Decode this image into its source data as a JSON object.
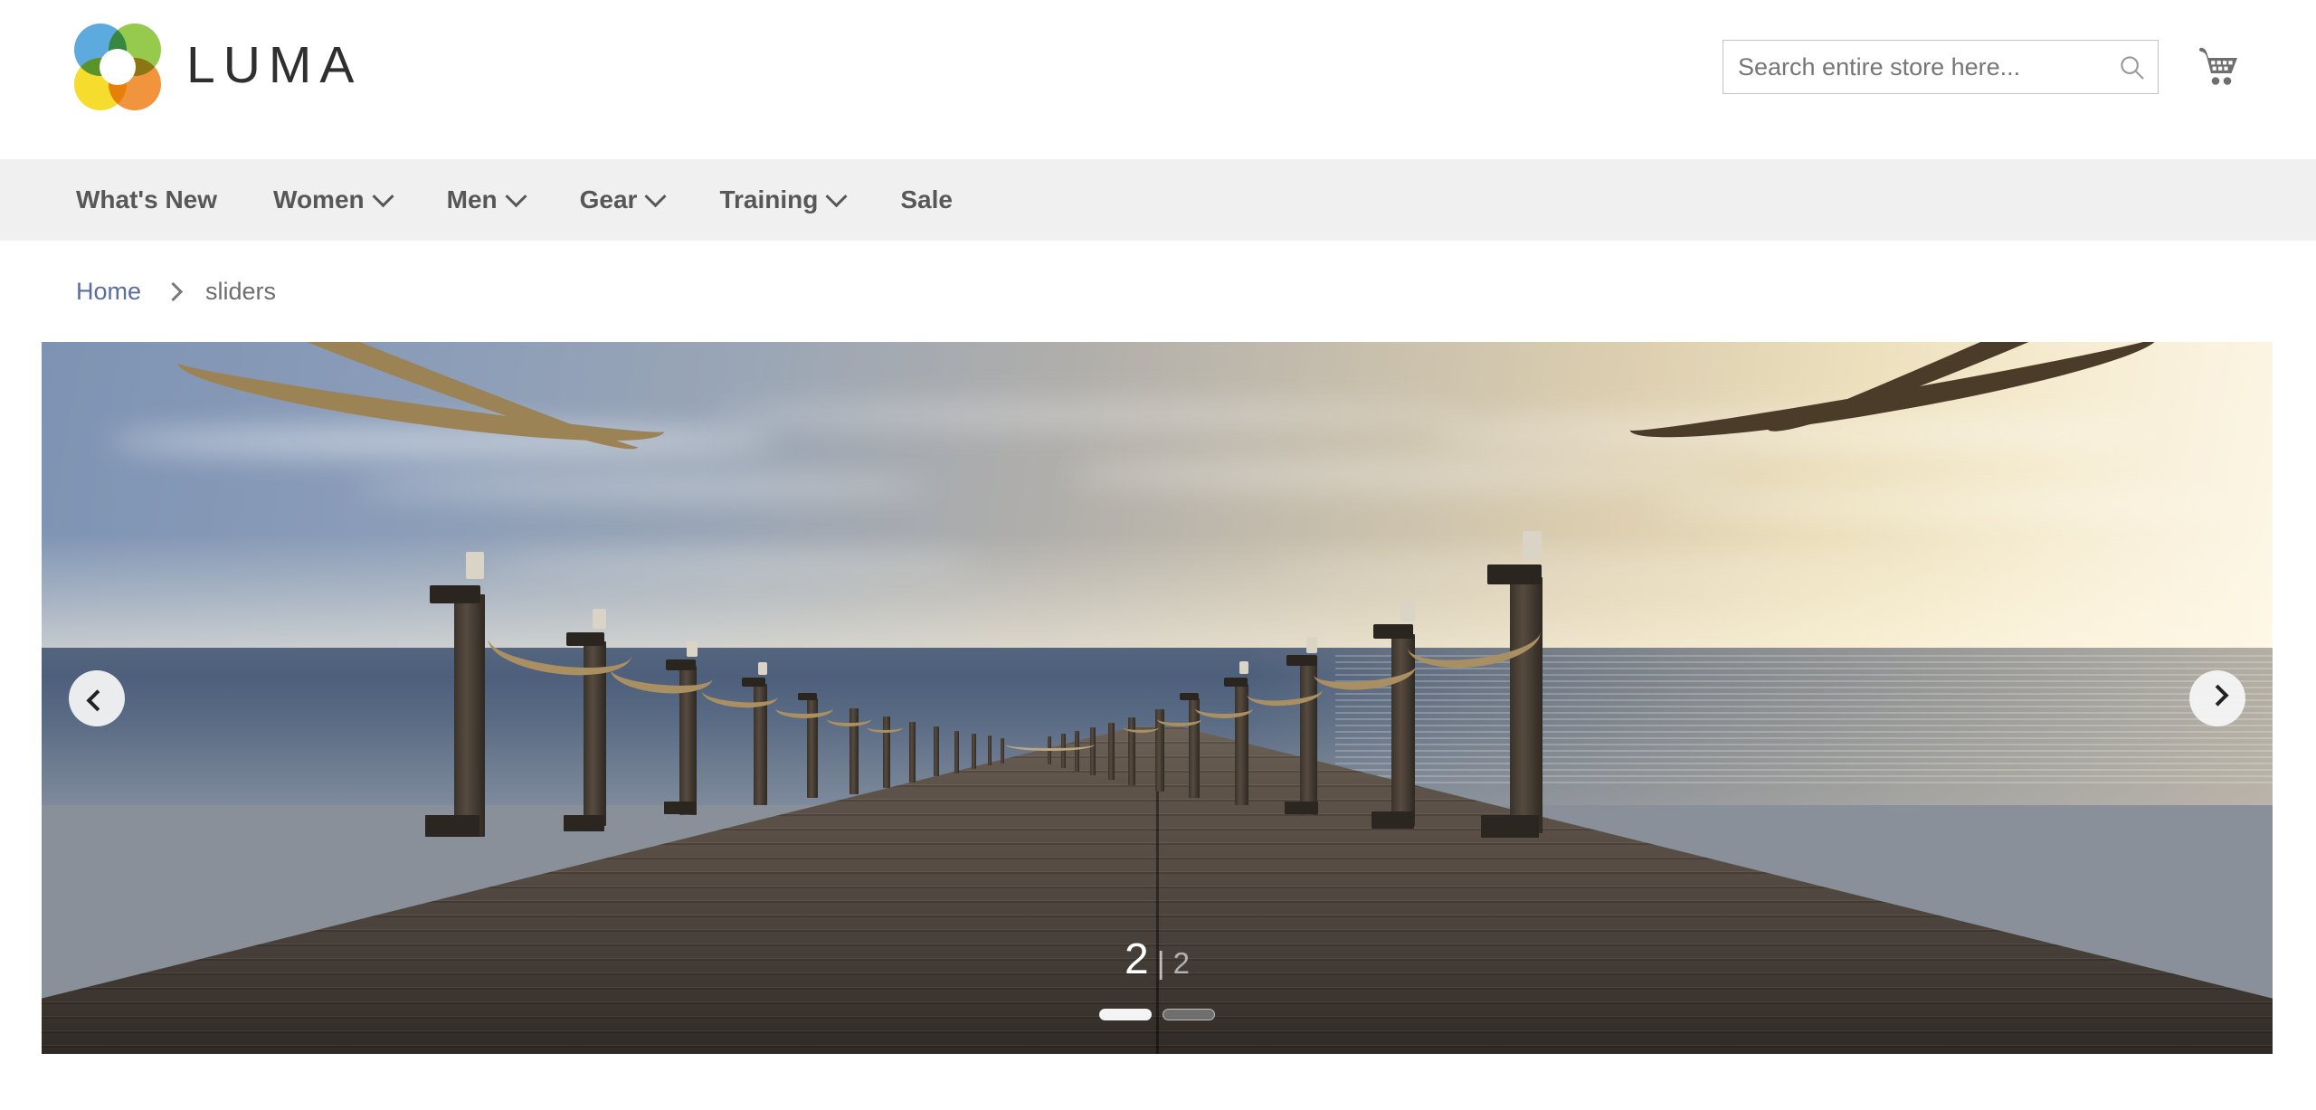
{
  "header": {
    "logo_text": "LUMA",
    "logo_icon": "luma-flower-logo",
    "logo_colors": {
      "blue": "#4fa3dc",
      "green": "#8cc63e",
      "yellow": "#f5d91b",
      "orange": "#ef8b2c"
    },
    "search": {
      "placeholder": "Search entire store here...",
      "value": "",
      "icon": "search-icon"
    },
    "cart": {
      "icon": "shopping-cart-icon"
    }
  },
  "nav": {
    "items": [
      {
        "label": "What's New",
        "has_dropdown": false
      },
      {
        "label": "Women",
        "has_dropdown": true
      },
      {
        "label": "Men",
        "has_dropdown": true
      },
      {
        "label": "Gear",
        "has_dropdown": true
      },
      {
        "label": "Training",
        "has_dropdown": true
      },
      {
        "label": "Sale",
        "has_dropdown": false
      }
    ]
  },
  "breadcrumb": {
    "home_label": "Home",
    "separator_icon": "chevron-right-icon",
    "current_label": "sliders"
  },
  "slider": {
    "image_description": "Wooden pier with rope railings receding toward the ocean horizon at sunset",
    "prev_icon": "chevron-left-icon",
    "next_icon": "chevron-right-icon",
    "counter": {
      "current": "2",
      "separator": "|",
      "total": "2"
    },
    "pagination": [
      {
        "index": 1,
        "state": "active"
      },
      {
        "index": 2,
        "state": "inactive"
      }
    ]
  },
  "colors": {
    "nav_background": "#f0f0f0",
    "page_background": "#ffffff",
    "link": "#5a6d9e",
    "text": "#575757"
  }
}
